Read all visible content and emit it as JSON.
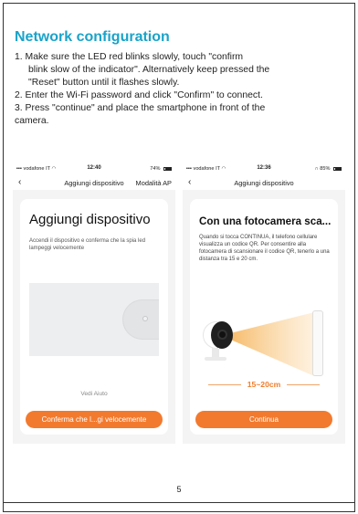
{
  "title": "Network configuration",
  "steps": [
    "1. Make sure the LED red blinks slowly, touch \"confirm",
    "blink slow of the indicator\". Alternatively keep pressed the",
    "\"Reset\" button until it flashes slowly.",
    "2. Enter the Wi-Fi password and click \"Confirm\" to connect.",
    "3. Press \"continue\" and place the smartphone in front of the",
    "camera."
  ],
  "phone_left": {
    "carrier": "vodafone IT",
    "time": "12:40",
    "battery": "74%",
    "back_icon": "chevron-left-icon",
    "nav_title": "Aggiungi dispositivo",
    "nav_right": "Modalità AP",
    "card_title": "Aggiungi dispositivo",
    "card_desc": "Accendi il dispositivo e conferma che la spia led lampeggi velocemente",
    "help_link": "Vedi Aiuto",
    "button": "Conferma che l...gi velocemente"
  },
  "phone_right": {
    "carrier": "vodafone IT",
    "time": "12:36",
    "battery": "85%",
    "back_icon": "chevron-left-icon",
    "nav_title": "Aggiungi dispositivo",
    "card_title": "Con una fotocamera sca...",
    "card_desc": "Quando si tocca CONTINUA, il telefono cellulare visualizza un codice QR. Per consentire alla fotocamera di scansionare il codice QR, tenerlo a una distanza tra 15 e 20 cm.",
    "distance": "15~20cm",
    "button": "Continua"
  },
  "page_number": "5",
  "colors": {
    "title": "#1aa3c9",
    "button": "#f27a2e",
    "beam": "#f5c07a",
    "distance": "#f07d2d"
  }
}
